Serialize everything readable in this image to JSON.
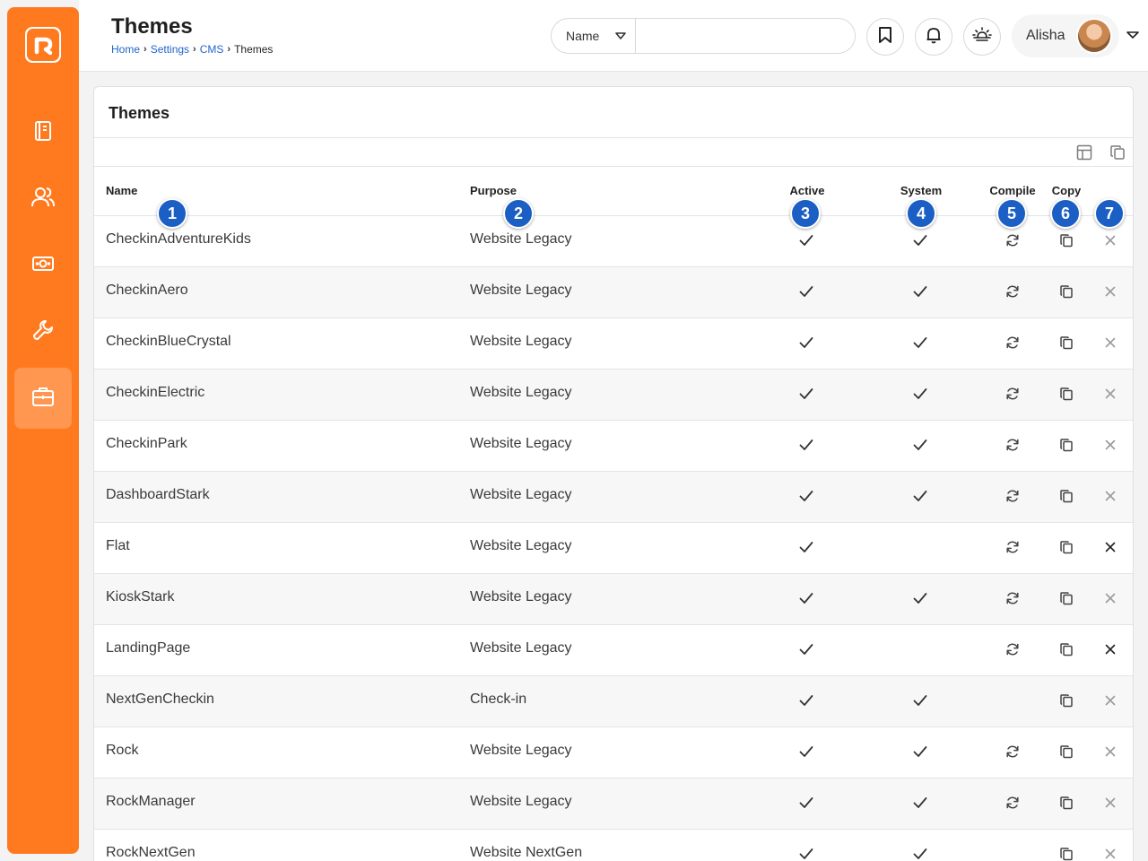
{
  "sidebar": {
    "items": [
      {
        "icon": "book-icon",
        "active": false
      },
      {
        "icon": "people-icon",
        "active": false
      },
      {
        "icon": "money-icon",
        "active": false
      },
      {
        "icon": "wrench-icon",
        "active": false
      },
      {
        "icon": "briefcase-icon",
        "active": true
      }
    ]
  },
  "header": {
    "title": "Themes",
    "breadcrumb": [
      "Home",
      "Settings",
      "CMS",
      "Themes"
    ],
    "search": {
      "select_value": "Name",
      "placeholder": ""
    },
    "user_name": "Alisha"
  },
  "card": {
    "title": "Themes",
    "columns": {
      "name": "Name",
      "purpose": "Purpose",
      "active": "Active",
      "system": "System",
      "compile": "Compile",
      "copy": "Copy"
    },
    "rows": [
      {
        "name": "CheckinAdventureKids",
        "purpose": "Website Legacy",
        "active": true,
        "system": true,
        "compile": true,
        "delete_enabled": false
      },
      {
        "name": "CheckinAero",
        "purpose": "Website Legacy",
        "active": true,
        "system": true,
        "compile": true,
        "delete_enabled": false
      },
      {
        "name": "CheckinBlueCrystal",
        "purpose": "Website Legacy",
        "active": true,
        "system": true,
        "compile": true,
        "delete_enabled": false
      },
      {
        "name": "CheckinElectric",
        "purpose": "Website Legacy",
        "active": true,
        "system": true,
        "compile": true,
        "delete_enabled": false
      },
      {
        "name": "CheckinPark",
        "purpose": "Website Legacy",
        "active": true,
        "system": true,
        "compile": true,
        "delete_enabled": false
      },
      {
        "name": "DashboardStark",
        "purpose": "Website Legacy",
        "active": true,
        "system": true,
        "compile": true,
        "delete_enabled": false
      },
      {
        "name": "Flat",
        "purpose": "Website Legacy",
        "active": true,
        "system": false,
        "compile": true,
        "delete_enabled": true
      },
      {
        "name": "KioskStark",
        "purpose": "Website Legacy",
        "active": true,
        "system": true,
        "compile": true,
        "delete_enabled": false
      },
      {
        "name": "LandingPage",
        "purpose": "Website Legacy",
        "active": true,
        "system": false,
        "compile": true,
        "delete_enabled": true
      },
      {
        "name": "NextGenCheckin",
        "purpose": "Check-in",
        "active": true,
        "system": true,
        "compile": false,
        "delete_enabled": false
      },
      {
        "name": "Rock",
        "purpose": "Website Legacy",
        "active": true,
        "system": true,
        "compile": true,
        "delete_enabled": false
      },
      {
        "name": "RockManager",
        "purpose": "Website Legacy",
        "active": true,
        "system": true,
        "compile": true,
        "delete_enabled": false
      },
      {
        "name": "RockNextGen",
        "purpose": "Website NextGen",
        "active": true,
        "system": true,
        "compile": false,
        "delete_enabled": false
      }
    ]
  },
  "callouts": [
    "1",
    "2",
    "3",
    "4",
    "5",
    "6",
    "7"
  ],
  "colors": {
    "brand": "#ff7a1f",
    "callout": "#1b5fc4",
    "link": "#2266cc"
  }
}
